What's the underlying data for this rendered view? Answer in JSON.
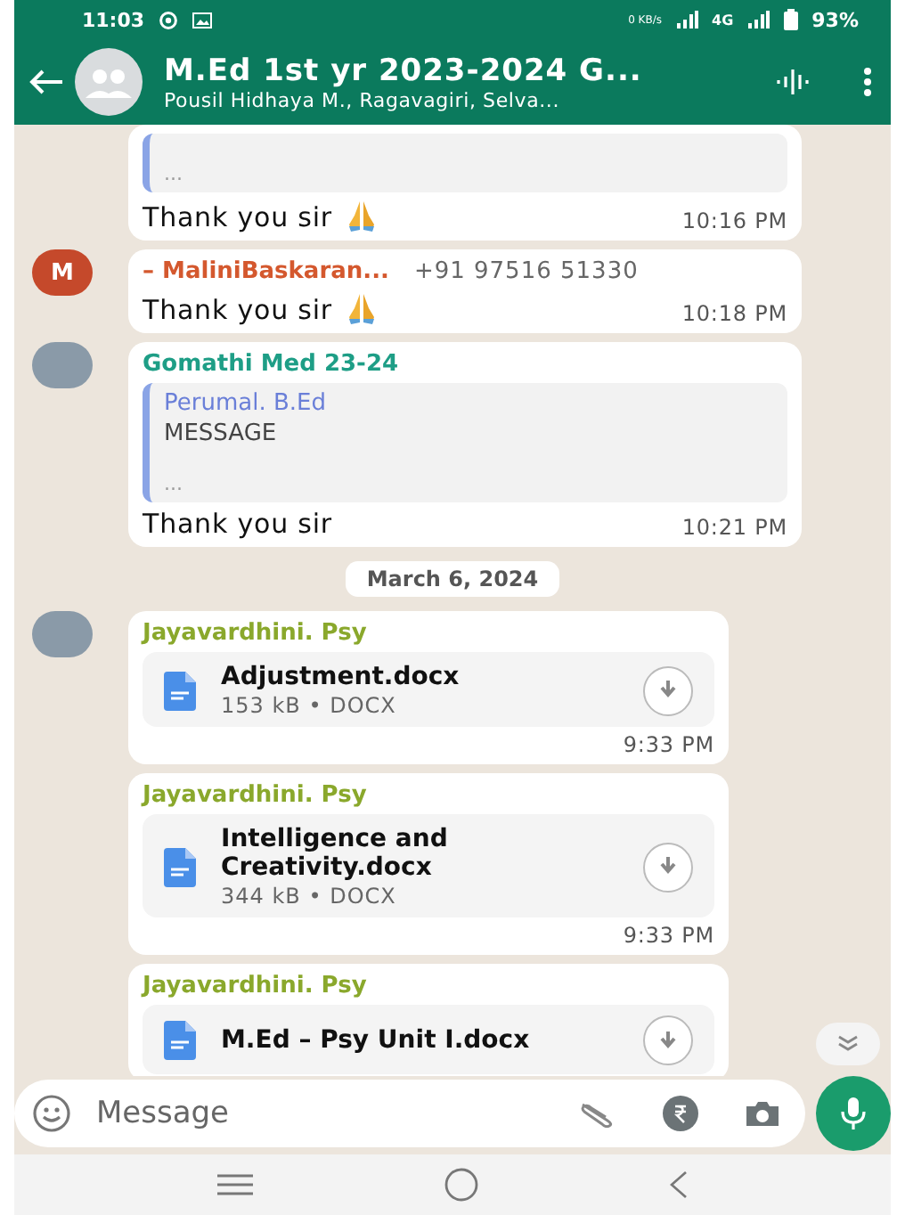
{
  "status_bar": {
    "time": "11:03",
    "data_rate": "0 KB/s",
    "network": "4G",
    "battery": "93%"
  },
  "header": {
    "title": "M.Ed 1st yr 2023-2024 G...",
    "subtitle": "Pousil Hidhaya M., Ragavagiri, Selva..."
  },
  "messages": [
    {
      "kind": "text",
      "quote": {
        "text": "..."
      },
      "text": "Thank you sir",
      "praying_hands": true,
      "time": "10:16 PM"
    },
    {
      "kind": "text",
      "avatar": {
        "kind": "letter",
        "letter": "M",
        "color": "#c5492b"
      },
      "sender": "– MaliniBaskaran...",
      "color": "#d4582e",
      "phone": "+91 97516 51330",
      "text": "Thank you sir",
      "praying_hands": true,
      "time": "10:18 PM"
    },
    {
      "kind": "text",
      "avatar": {
        "kind": "photo"
      },
      "sender": "Gomathi Med 23-24",
      "color": "#1e9e86",
      "quote": {
        "author": "Perumal. B.Ed",
        "text": "MESSAGE",
        "more": "..."
      },
      "text": "Thank you sir",
      "praying_hands": false,
      "time": "10:21 PM"
    },
    {
      "kind": "date",
      "text": "March 6, 2024"
    },
    {
      "kind": "file",
      "avatar": {
        "kind": "photo"
      },
      "sender": "Jayavardhini. Psy",
      "color": "#8aa82c",
      "file": "Adjustment.docx",
      "meta": "153 kB • DOCX",
      "time": "9:33 PM"
    },
    {
      "kind": "file",
      "sender": "Jayavardhini. Psy",
      "color": "#8aa82c",
      "file": "Intelligence and Creativity.docx",
      "meta": "344 kB • DOCX",
      "time": "9:33 PM"
    },
    {
      "kind": "file",
      "sender": "Jayavardhini. Psy",
      "color": "#8aa82c",
      "file": "M.Ed – Psy Unit I.docx"
    }
  ],
  "composer": {
    "placeholder": "Message"
  }
}
